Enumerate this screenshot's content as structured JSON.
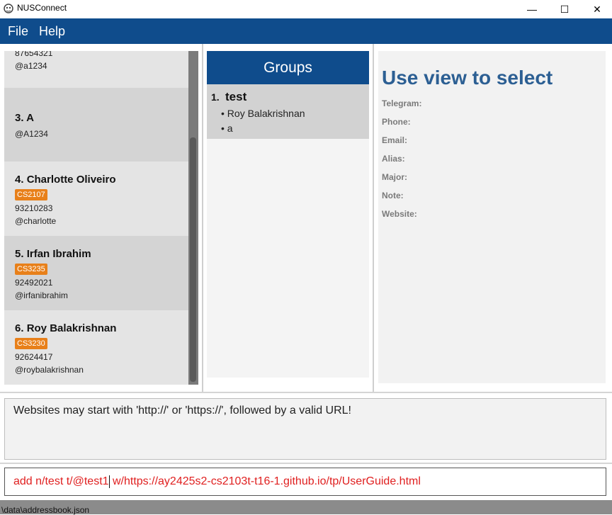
{
  "window": {
    "title": "NUSConnect",
    "controls": {
      "minimize": "—",
      "maximize": "☐",
      "close": "✕"
    }
  },
  "menu": {
    "items": [
      "File",
      "Help"
    ]
  },
  "person_list": {
    "cards": [
      {
        "index": "",
        "name": "",
        "tags": [],
        "phone": "87654321",
        "telegram": "@a1234"
      },
      {
        "index": "3.",
        "name": "A",
        "tags": [],
        "phone": "",
        "telegram": "@A1234"
      },
      {
        "index": "4.",
        "name": "Charlotte Oliveiro",
        "tags": [
          "CS2107"
        ],
        "phone": "93210283",
        "telegram": "@charlotte"
      },
      {
        "index": "5.",
        "name": "Irfan Ibrahim",
        "tags": [
          "CS3235"
        ],
        "phone": "92492021",
        "telegram": "@irfanibrahim"
      },
      {
        "index": "6.",
        "name": "Roy Balakrishnan",
        "tags": [
          "CS3230"
        ],
        "phone": "92624417",
        "telegram": "@roybalakrishnan"
      }
    ]
  },
  "groups": {
    "header": "Groups",
    "items": [
      {
        "index": "1.",
        "name": "test",
        "members": [
          "Roy Balakrishnan",
          "a"
        ]
      }
    ]
  },
  "detail": {
    "title": "Use view to select",
    "labels": [
      "Telegram:",
      "Phone:",
      "Email:",
      "Alias:",
      "Major:",
      "Note:",
      "Website:"
    ]
  },
  "result": {
    "text": "Websites may start with 'http://' or 'https://', followed by a valid URL!"
  },
  "command": {
    "before_cursor": "add n/test t/@test1",
    "after_cursor": " w/https://ay2425s2-cs2103t-t16-1.github.io/tp/UserGuide.html"
  },
  "status": {
    "path": "\\data\\addressbook.json"
  },
  "colors": {
    "menubar": "#0f4c8c",
    "tag": "#e8801a",
    "error_text": "#e02020",
    "detail_title": "#2c5f93"
  }
}
